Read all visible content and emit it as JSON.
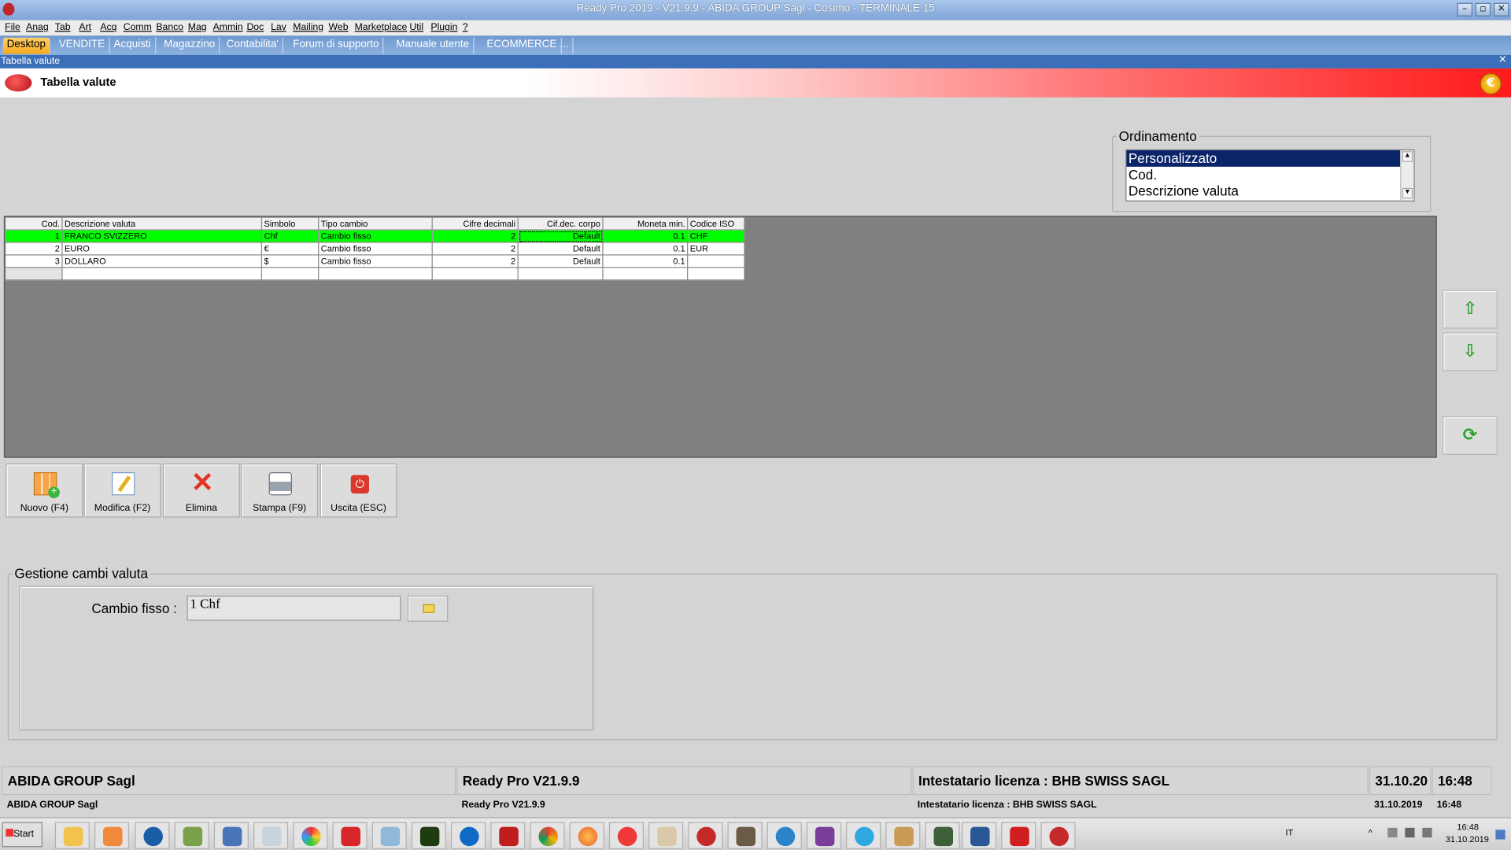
{
  "window": {
    "title": "Ready Pro 2019 - V21.9.9 - ABIDA GROUP Sagl - Cosimo - TERMINALE 15",
    "min": "–",
    "max": "▫",
    "close": "✕"
  },
  "menu": [
    "File",
    "Anag",
    "Tab",
    "Art",
    "Acq",
    "Comm",
    "Banco",
    "Mag",
    "Ammin",
    "Doc",
    "Lav",
    "Mailing",
    "Web",
    "Marketplace",
    "Util",
    "Plugin",
    "?"
  ],
  "tabs": [
    "Desktop",
    "VENDITE",
    "Acquisti",
    "Magazzino",
    "Contabilita'",
    "Forum di supporto",
    "Manuale utente",
    "ECOMMERCE",
    "..."
  ],
  "panel": {
    "caption": "Tabella valute",
    "close": "✕"
  },
  "header": {
    "title": "Tabella valute",
    "coin": "€"
  },
  "ordinamento": {
    "legend": "Ordinamento",
    "options": [
      "Personalizzato",
      "Cod.",
      "Descrizione valuta"
    ],
    "selected": "Personalizzato",
    "up": "▲",
    "down": "▼"
  },
  "table": {
    "columns": [
      "Cod.",
      "Descrizione valuta",
      "Simbolo",
      "Tipo cambio",
      "Cifre decimali",
      "Cif.dec. corpo",
      "Moneta min.",
      "Codice ISO"
    ],
    "rows": [
      {
        "cod": "1",
        "desc": "FRANCO SVIZZERO",
        "simbolo": "Chf",
        "tipo": "Cambio fisso",
        "cifre": "2",
        "corpo": "Default",
        "moneta": "0.1",
        "iso": "CHF"
      },
      {
        "cod": "2",
        "desc": "EURO",
        "simbolo": "€",
        "tipo": "Cambio fisso",
        "cifre": "2",
        "corpo": "Default",
        "moneta": "0.1",
        "iso": "EUR"
      },
      {
        "cod": "3",
        "desc": "DOLLARO",
        "simbolo": "$",
        "tipo": "Cambio fisso",
        "cifre": "2",
        "corpo": "Default",
        "moneta": "0.1",
        "iso": ""
      }
    ]
  },
  "side": {
    "up": "⇧",
    "down": "⇩",
    "refresh": "⟳"
  },
  "toolbar": {
    "nuovo": "Nuovo (F4)",
    "modifica": "Modifica (F2)",
    "elimina": "Elimina",
    "stampa": "Stampa (F9)",
    "uscita": "Uscita (ESC)"
  },
  "gestione": {
    "legend": "Gestione cambi valuta",
    "label": "Cambio fisso :",
    "value": "1 Chf"
  },
  "status": {
    "company": "ABIDA GROUP Sagl",
    "version": "Ready Pro V21.9.9",
    "license": "Intestatario licenza : BHB SWISS SAGL",
    "date": "31.10.20",
    "time": "16:48",
    "date_full": "31.10.2019"
  },
  "taskbar": {
    "start": "Start",
    "lang": "IT",
    "time": "16:48",
    "date": "31.10.2019"
  },
  "colors": {
    "highlight": "#00ff00",
    "selection": "#0a246a",
    "tab_active": "#f6a91c"
  }
}
